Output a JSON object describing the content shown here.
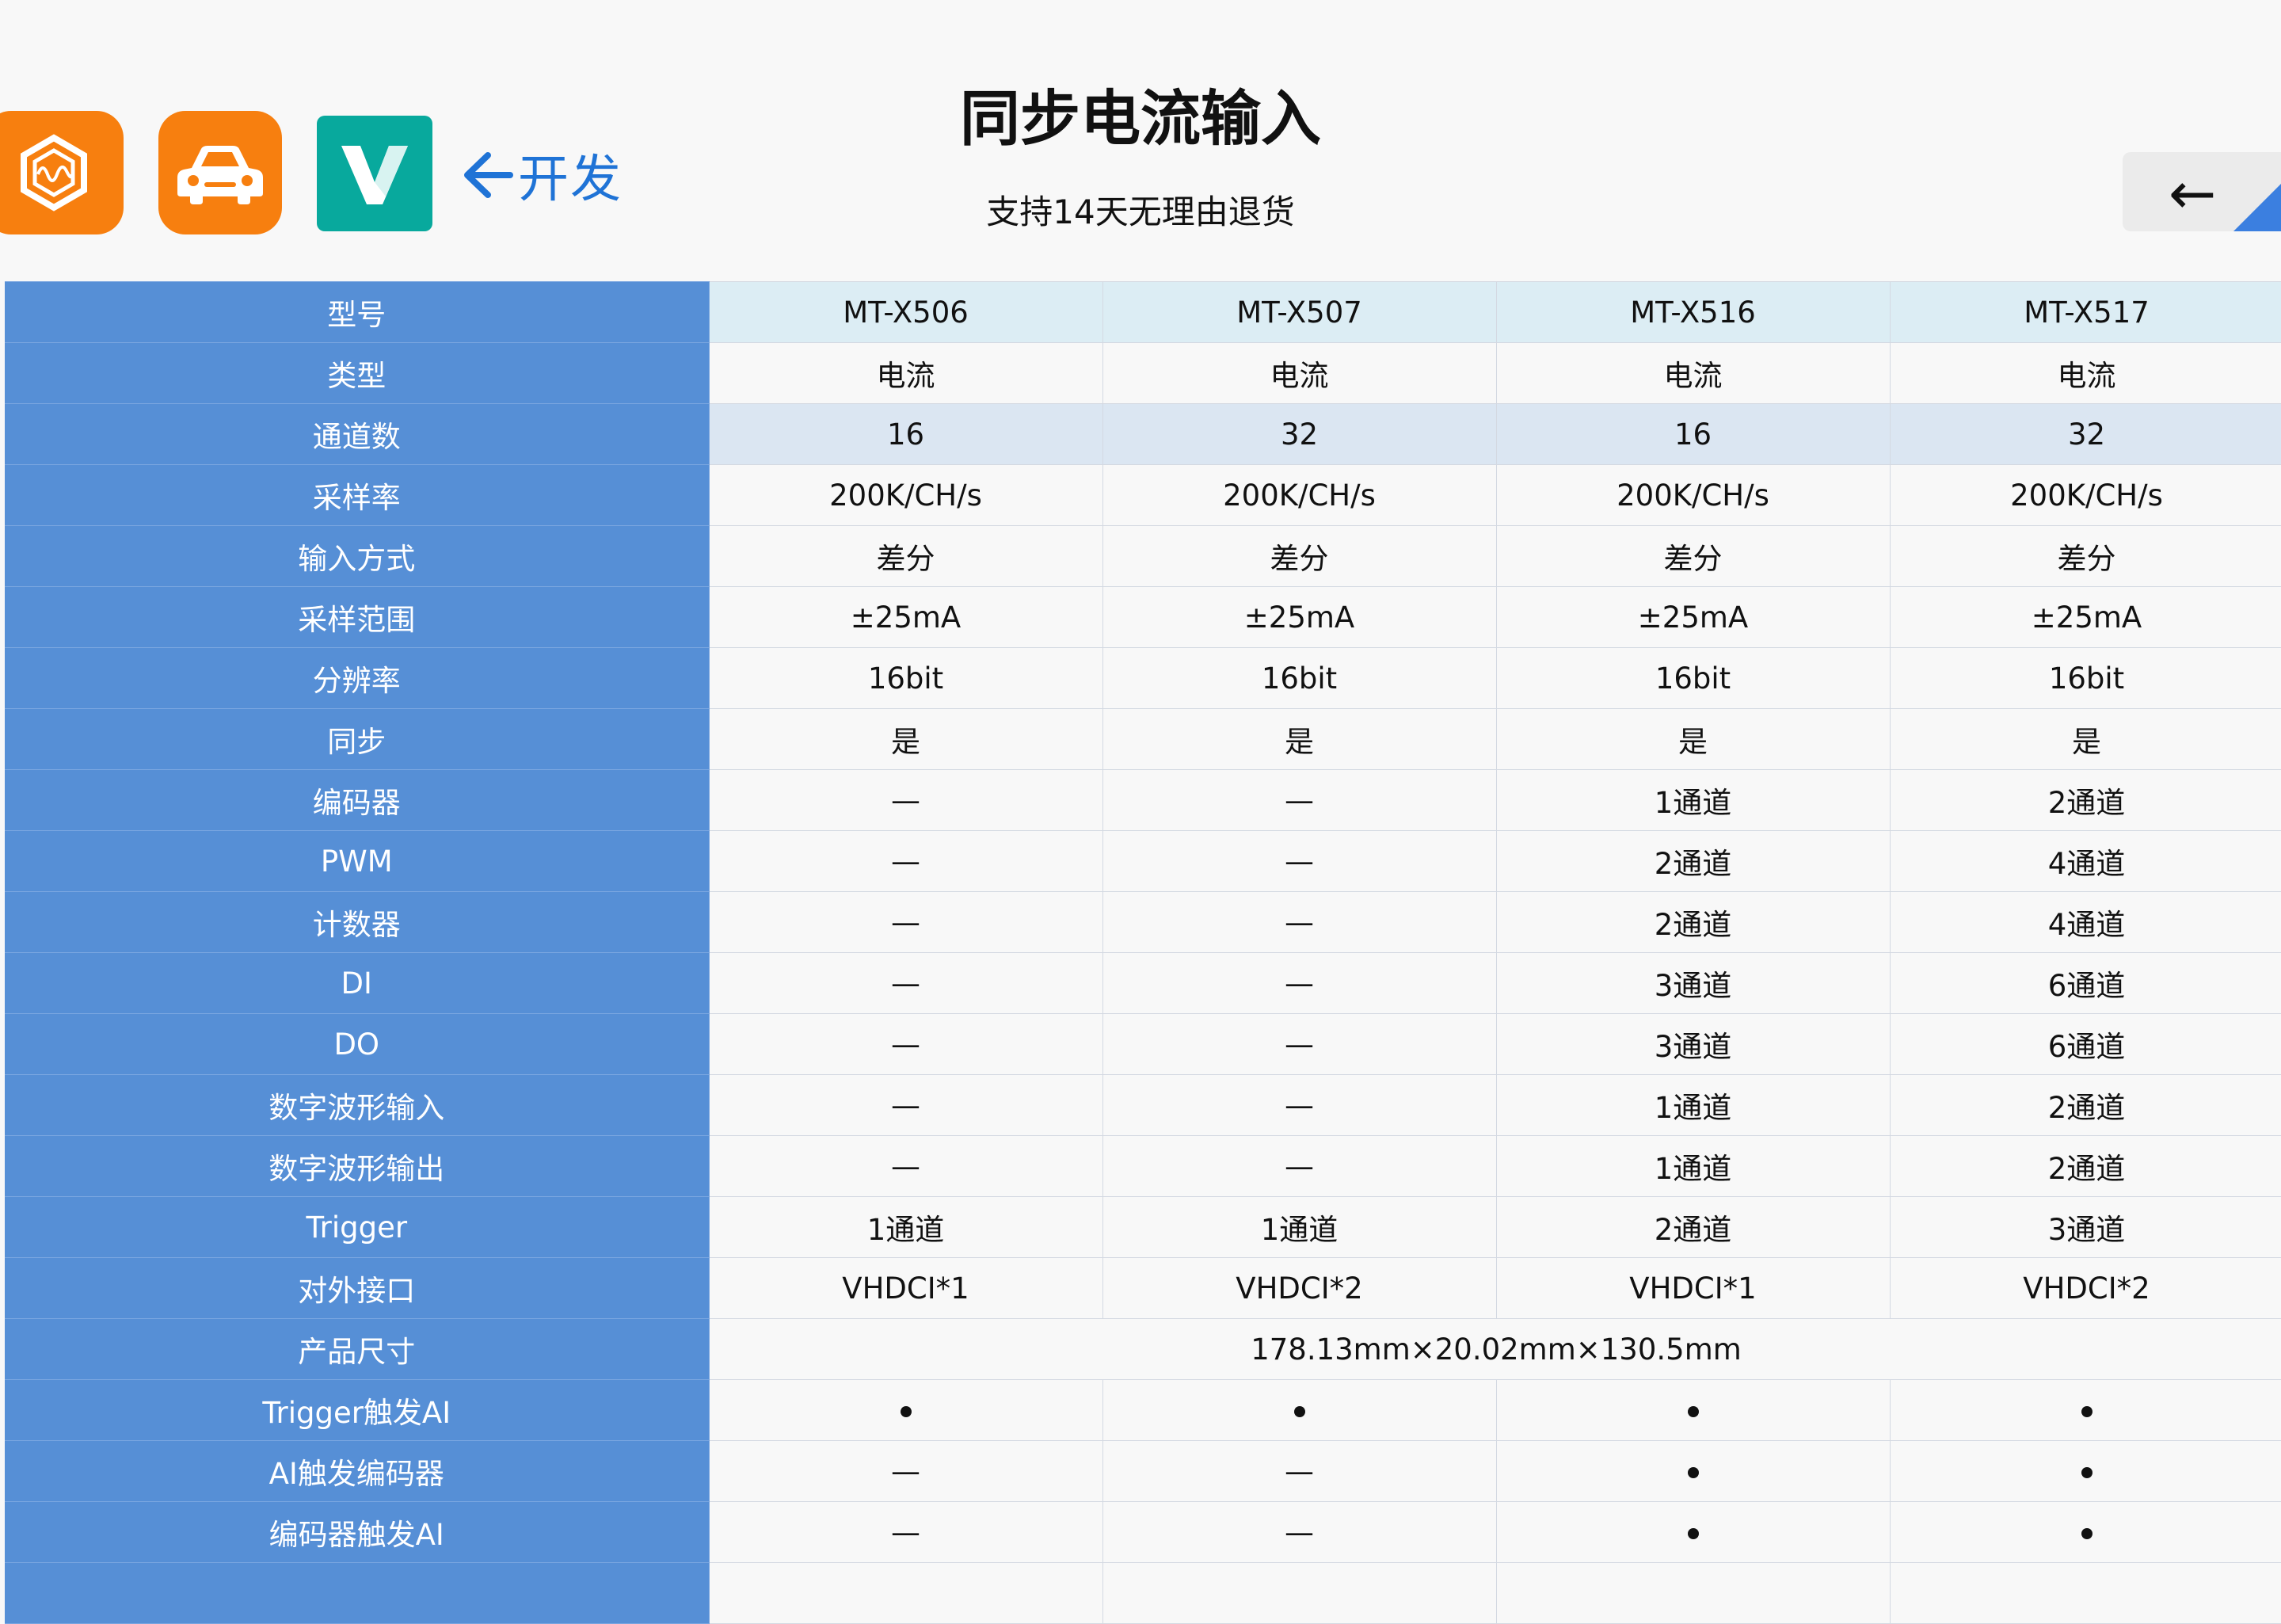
{
  "header": {
    "title": "同步电流输入",
    "subtitle": "支持14天无理由退货",
    "dev_link_label": "开发",
    "back_label": "←",
    "icons": [
      {
        "name": "waveform-app-icon",
        "color": "#f77f0f"
      },
      {
        "name": "car-app-icon",
        "color": "#f77f0f"
      },
      {
        "name": "v-logo-app-icon",
        "color": "#08a99d"
      }
    ]
  },
  "table": {
    "rows": [
      {
        "label": "型号",
        "values": [
          "MT-X506",
          "MT-X507",
          "MT-X516",
          "MT-X517"
        ]
      },
      {
        "label": "类型",
        "values": [
          "电流",
          "电流",
          "电流",
          "电流"
        ]
      },
      {
        "label": "通道数",
        "values": [
          "16",
          "32",
          "16",
          "32"
        ]
      },
      {
        "label": "采样率",
        "values": [
          "200K/CH/s",
          "200K/CH/s",
          "200K/CH/s",
          "200K/CH/s"
        ]
      },
      {
        "label": "输入方式",
        "values": [
          "差分",
          "差分",
          "差分",
          "差分"
        ]
      },
      {
        "label": "采样范围",
        "values": [
          "±25mA",
          "±25mA",
          "±25mA",
          "±25mA"
        ]
      },
      {
        "label": "分辨率",
        "values": [
          "16bit",
          "16bit",
          "16bit",
          "16bit"
        ]
      },
      {
        "label": "同步",
        "values": [
          "是",
          "是",
          "是",
          "是"
        ]
      },
      {
        "label": "编码器",
        "values": [
          "—",
          "—",
          "1通道",
          "2通道"
        ]
      },
      {
        "label": "PWM",
        "values": [
          "—",
          "—",
          "2通道",
          "4通道"
        ]
      },
      {
        "label": "计数器",
        "values": [
          "—",
          "—",
          "2通道",
          "4通道"
        ]
      },
      {
        "label": "DI",
        "values": [
          "—",
          "—",
          "3通道",
          "6通道"
        ]
      },
      {
        "label": "DO",
        "values": [
          "—",
          "—",
          "3通道",
          "6通道"
        ]
      },
      {
        "label": "数字波形输入",
        "values": [
          "—",
          "—",
          "1通道",
          "2通道"
        ]
      },
      {
        "label": "数字波形输出",
        "values": [
          "—",
          "—",
          "1通道",
          "2通道"
        ]
      },
      {
        "label": "Trigger",
        "values": [
          "1通道",
          "1通道",
          "2通道",
          "3通道"
        ]
      },
      {
        "label": "对外接口",
        "values": [
          "VHDCI*1",
          "VHDCI*2",
          "VHDCI*1",
          "VHDCI*2"
        ]
      },
      {
        "label": "产品尺寸",
        "merged_value": "178.13mm×20.02mm×130.5mm"
      },
      {
        "label": "Trigger触发AI",
        "values": [
          "●",
          "●",
          "●",
          "●"
        ]
      },
      {
        "label": "AI触发编码器",
        "values": [
          "—",
          "—",
          "●",
          "●"
        ]
      },
      {
        "label": "编码器触发AI",
        "values": [
          "—",
          "—",
          "●",
          "●"
        ]
      },
      {
        "label": "",
        "values": [
          "",
          "",
          "",
          ""
        ]
      }
    ]
  }
}
